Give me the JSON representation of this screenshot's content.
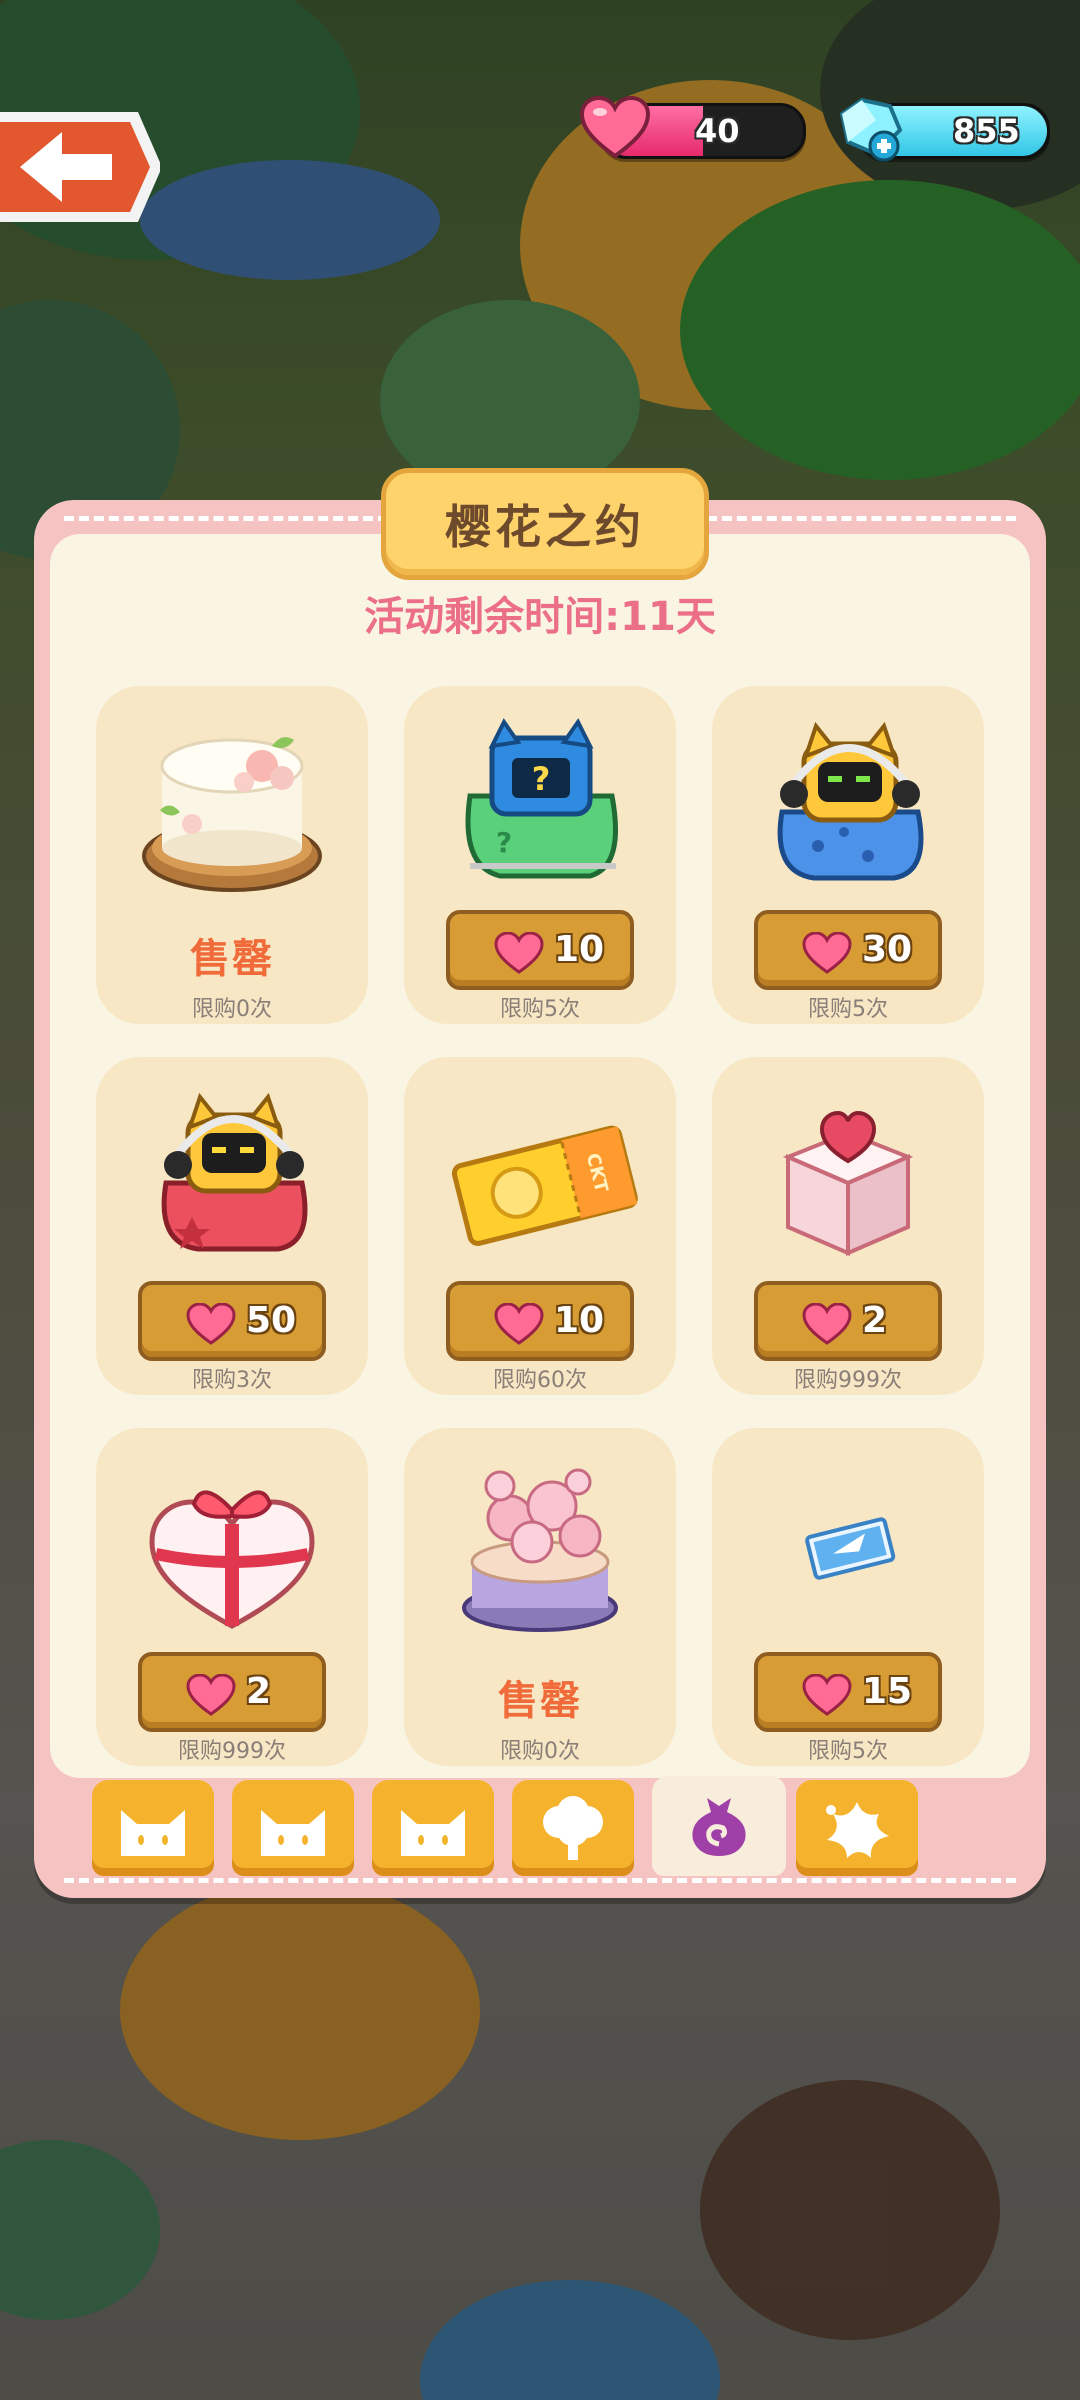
{
  "hud": {
    "hearts": "40",
    "gems": "855"
  },
  "panel": {
    "title": "樱花之约",
    "countdown": "活动剩余时间:11天"
  },
  "items": [
    {
      "kind": "sold",
      "sold_label": "售罄",
      "limit": "限购0次",
      "icon": "flower-cake-icon"
    },
    {
      "kind": "price",
      "price": "10",
      "limit": "限购5次",
      "icon": "mystery-gift-bag-icon"
    },
    {
      "kind": "price",
      "price": "30",
      "limit": "限购5次",
      "icon": "robot-cat-blue-bag-icon"
    },
    {
      "kind": "price",
      "price": "50",
      "limit": "限购3次",
      "icon": "robot-cat-red-bag-icon"
    },
    {
      "kind": "price",
      "price": "10",
      "limit": "限购60次",
      "icon": "golden-ticket-icon"
    },
    {
      "kind": "price",
      "price": "2",
      "limit": "限购999次",
      "icon": "heart-cake-icon"
    },
    {
      "kind": "price",
      "price": "2",
      "limit": "限购999次",
      "icon": "heart-gift-box-icon"
    },
    {
      "kind": "sold",
      "sold_label": "售罄",
      "limit": "限购0次",
      "icon": "sakura-cake-icon"
    },
    {
      "kind": "price",
      "price": "15",
      "limit": "限购5次",
      "icon": "blue-ticket-icon"
    }
  ],
  "tabs": [
    {
      "icon": "cat-face-icon",
      "active": false
    },
    {
      "icon": "cat-face-icon",
      "active": false
    },
    {
      "icon": "cat-face-icon",
      "active": false
    },
    {
      "icon": "tree-icon",
      "active": false
    },
    {
      "icon": "swirl-bag-icon",
      "active": true
    },
    {
      "icon": "star-splash-icon",
      "active": false
    }
  ],
  "colors": {
    "panel_border": "#f6c3c3",
    "panel_bg": "#faf4e3",
    "card_bg": "#f7e7c4",
    "price_button": "#d79c33",
    "sold_text": "#f06a3a",
    "countdown_text": "#ec6f8a",
    "tab_bg": "#f5b32d"
  }
}
